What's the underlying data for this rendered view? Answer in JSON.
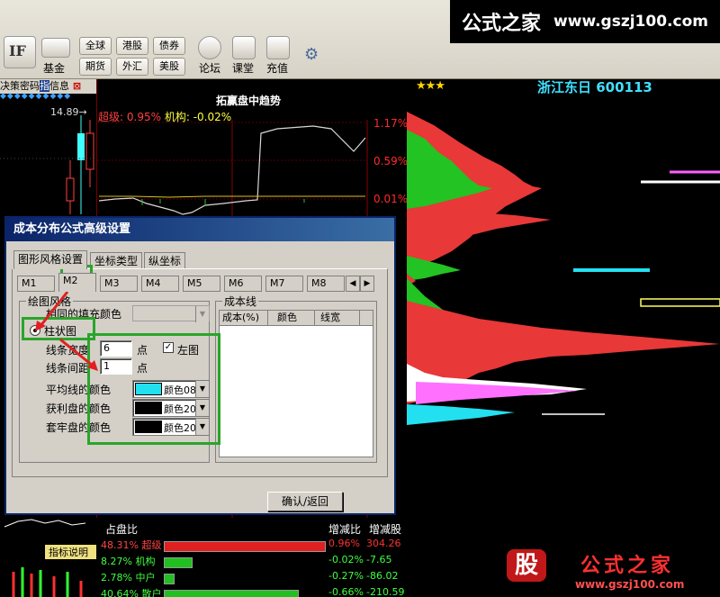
{
  "watermark": {
    "brand_cn": "公式之家",
    "url": "www.gszj100.com"
  },
  "toolbar": {
    "if_icon": "IF",
    "fund_label": "基金",
    "global_label": "全球",
    "hk_label": "港股",
    "bond_label": "债券",
    "futures_label": "期货",
    "fx_label": "外汇",
    "us_label": "美股",
    "forum_label": "论坛",
    "classroom_label": "课堂",
    "recharge_label": "充值"
  },
  "left": {
    "tab_text": "决策密码",
    "tab_indicator": "指",
    "tab_info": "信息",
    "price": "14.89"
  },
  "chart": {
    "title": "拓赢盘中趋势",
    "stat1_label": "超级:",
    "stat1_value": "0.95%",
    "stat2_label": "机构:",
    "stat2_value": "-0.02%",
    "pct_top": "1.17%",
    "pct_mid": "0.59%",
    "pct_low": "0.01%"
  },
  "header": {
    "stars": "★★★",
    "stock": "浙江东日  600113"
  },
  "dialog": {
    "title": "成本分布公式高级设置",
    "tabs": [
      "图形风格设置",
      "坐标类型",
      "纵坐标"
    ],
    "subtabs": [
      "M1",
      "M2",
      "M3",
      "M4",
      "M5",
      "M6",
      "M7",
      "M8"
    ],
    "drawing_style_legend": "绘图风格",
    "fill_color_label": "相同的填充颜色",
    "bar_radio_label": "柱状图",
    "line_width_label": "线条宽度",
    "line_width_value": "6",
    "line_width_unit": "点",
    "left_chart_label": "左图",
    "line_spacing_label": "线条间距",
    "line_spacing_value": "1",
    "line_spacing_unit": "点",
    "avg_color_label": "平均线的颜色",
    "avg_color_value": "颜色08",
    "avg_color_hex": "#22e0ef",
    "profit_color_label": "获利盘的颜色",
    "profit_color_value": "颜色20",
    "trapped_color_label": "套牢盘的颜色",
    "trapped_color_value": "颜色20",
    "cost_line_legend": "成本线",
    "cost_cols": [
      "成本(%)",
      "颜色",
      "线宽"
    ],
    "confirm_button": "确认/返回"
  },
  "bottom": {
    "header_label": "占盘比",
    "col1": "增减比",
    "col2": "增减股",
    "indicator_label": "指标说明",
    "rows": [
      {
        "pct": "48.31%",
        "name": "超级",
        "chg": "0.96%",
        "shares": "304.26",
        "color": "#e02020"
      },
      {
        "pct": "8.27%",
        "name": "机构",
        "chg": "-0.02%",
        "shares": "-7.65",
        "color": "#20c020"
      },
      {
        "pct": "2.78%",
        "name": "中户",
        "chg": "-0.27%",
        "shares": "-86.02",
        "color": "#20c020"
      },
      {
        "pct": "40.64%",
        "name": "散户",
        "chg": "-0.66%",
        "shares": "-210.59",
        "color": "#20c020"
      }
    ]
  },
  "watermark_bottom": {
    "logo": "股",
    "brand_cn": "公式之家",
    "url": "www.gszj100.com"
  }
}
